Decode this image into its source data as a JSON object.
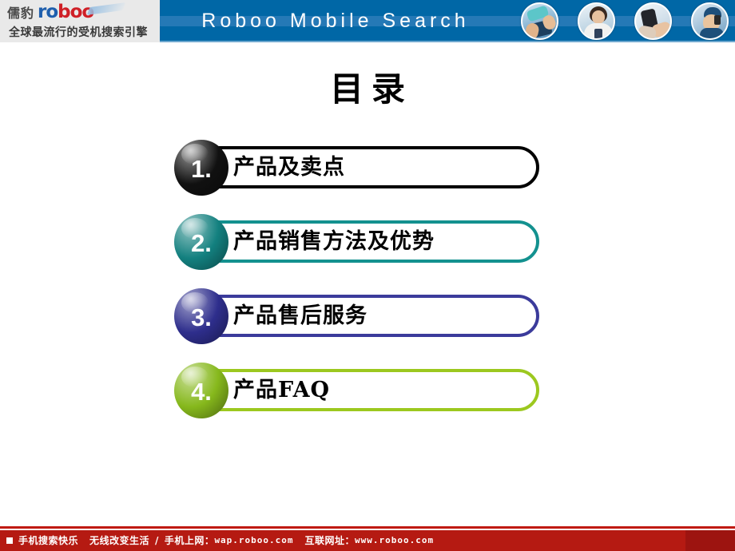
{
  "header": {
    "title": "Roboo Mobile Search",
    "logo": {
      "cn_name": "儒豹",
      "wordmark_blue": "ro",
      "wordmark_red": "boo",
      "tagline": "全球最流行的受机搜索引擎"
    },
    "photos": [
      {
        "name": "photo-hands-phone"
      },
      {
        "name": "photo-girl-phone"
      },
      {
        "name": "photo-hand-device"
      },
      {
        "name": "photo-man-phone"
      }
    ],
    "colors": {
      "bar_blue": "#0067a6",
      "band_blue": "#2b7db8",
      "logo_gray": "#e9e9e9"
    }
  },
  "slide": {
    "title": "目录"
  },
  "toc": {
    "items": [
      {
        "number": "1.",
        "label": "产品及卖点",
        "badge_color": "#111111",
        "outline_color": "#000000"
      },
      {
        "number": "2.",
        "label": "产品销售方法及优势",
        "badge_color": "#13807f",
        "outline_color": "#13918f"
      },
      {
        "number": "3.",
        "label": "产品售后服务",
        "badge_color": "#2e2e8c",
        "outline_color": "#3b3b9b"
      },
      {
        "number": "4.",
        "label": "产品FAQ",
        "badge_color": "#86b81c",
        "outline_color": "#9cc81f"
      }
    ]
  },
  "footer": {
    "bullet": "square-bullet-icon",
    "slogan_1": "手机搜索快乐",
    "slogan_2": "无线改变生活",
    "separator": "/",
    "wap_label": "手机上网：",
    "wap_url": "wap.roboo.com",
    "web_label": "互联网址：",
    "web_url": "www.roboo.com",
    "bar_color": "#b51a12"
  }
}
